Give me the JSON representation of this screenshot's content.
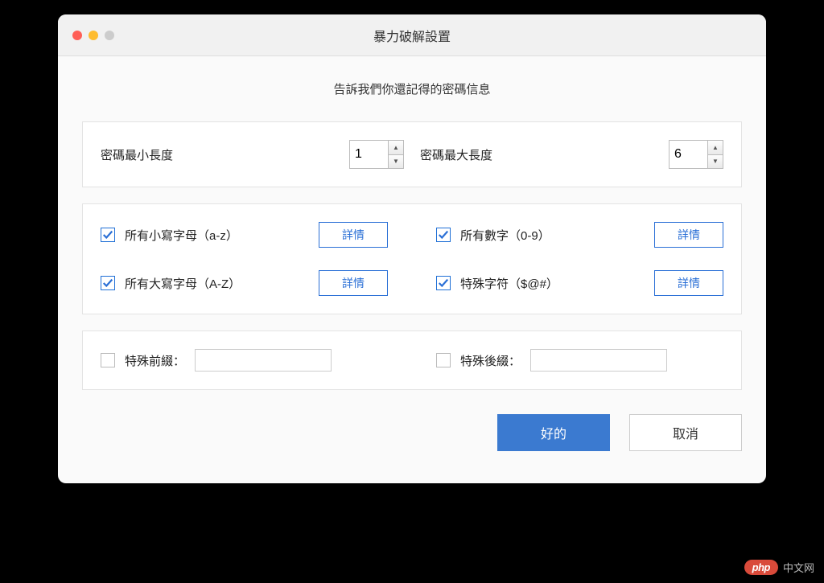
{
  "window": {
    "title": "暴力破解設置",
    "subtitle": "告訴我們你還記得的密碼信息"
  },
  "length": {
    "min_label": "密碼最小長度",
    "min_value": "1",
    "max_label": "密碼最大長度",
    "max_value": "6"
  },
  "charsets": {
    "lowercase": {
      "label": "所有小寫字母（a-z）",
      "details": "詳情"
    },
    "digits": {
      "label": "所有數字（0-9）",
      "details": "詳情"
    },
    "uppercase": {
      "label": "所有大寫字母（A-Z）",
      "details": "詳情"
    },
    "special": {
      "label": "特殊字符（$@#）",
      "details": "詳情"
    }
  },
  "affix": {
    "prefix_label": "特殊前綴：",
    "prefix_value": "",
    "suffix_label": "特殊後綴：",
    "suffix_value": ""
  },
  "footer": {
    "ok_label": "好的",
    "cancel_label": "取消"
  },
  "watermark": {
    "badge": "php",
    "text": "中文网"
  }
}
